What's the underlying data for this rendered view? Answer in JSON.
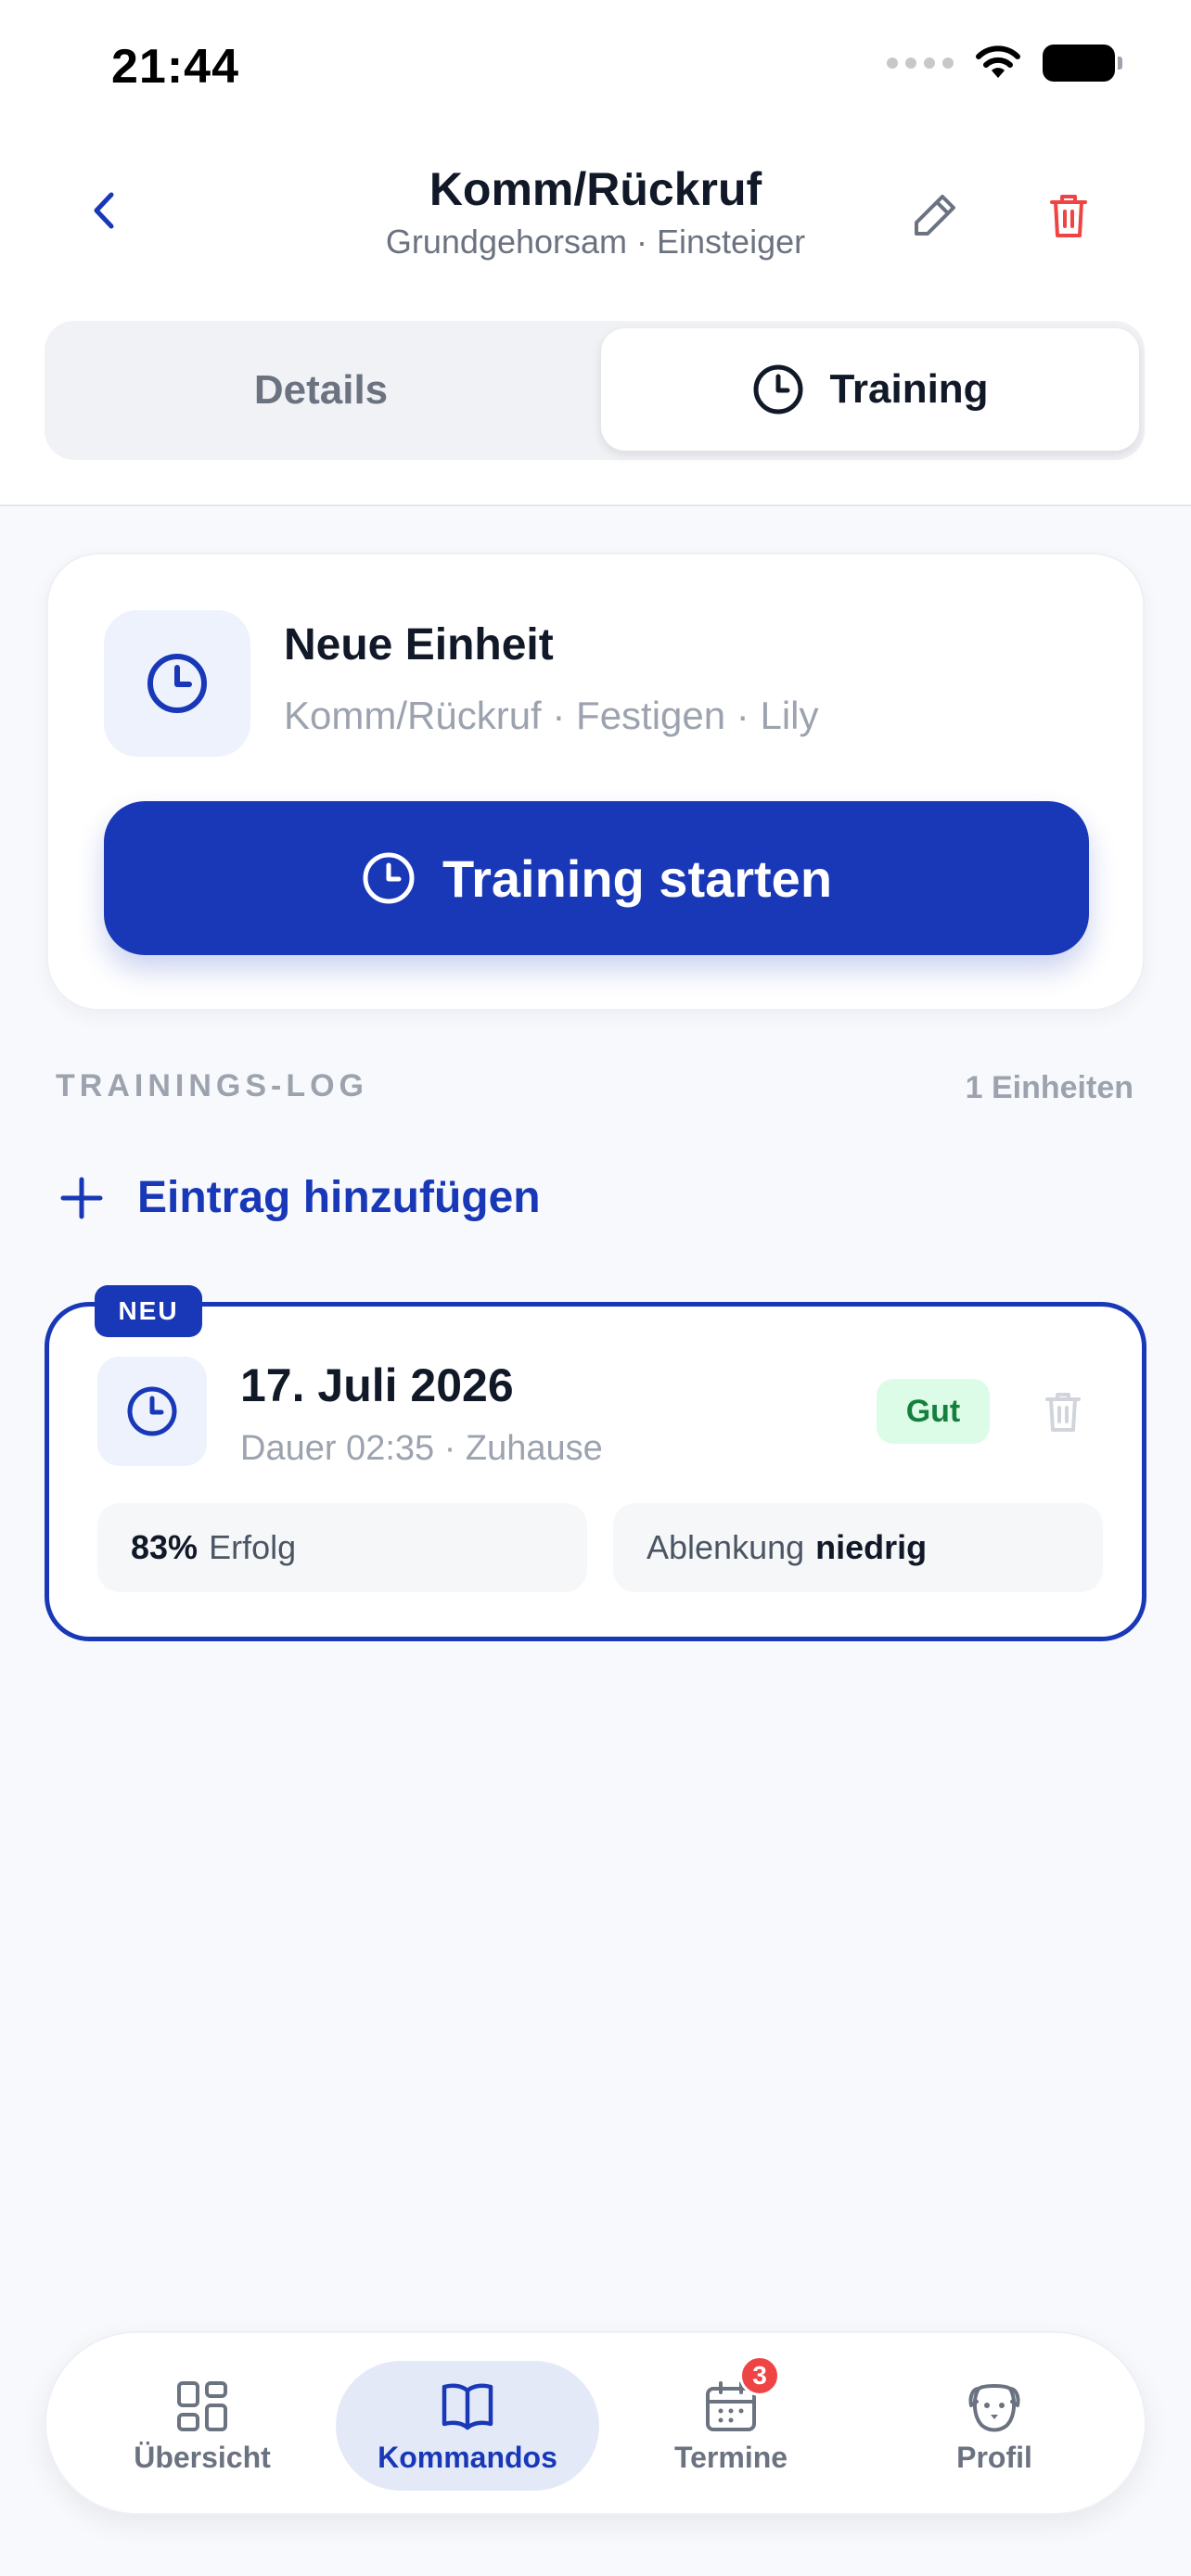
{
  "status_bar": {
    "time": "21:44"
  },
  "header": {
    "title": "Komm/Rückruf",
    "subtitle": "Grundgehorsam · Einsteiger"
  },
  "segments": {
    "details_label": "Details",
    "training_label": "Training",
    "selected": "Training"
  },
  "start_card": {
    "title": "Neue Einheit",
    "subtitle": "Komm/Rückruf · Festigen · Lily",
    "button_label": "Training starten"
  },
  "log": {
    "header": "TRAININGS-LOG",
    "count": "1 Einheiten",
    "add_label": "Eintrag hinzufügen"
  },
  "entry": {
    "badge": "NEU",
    "date": "17. Juli 2026",
    "meta": "Dauer 02:35 · Zuhause",
    "rating": "Gut",
    "success_value": "83%",
    "success_label": "Erfolg",
    "distraction_label": "Ablenkung",
    "distraction_value": "niedrig"
  },
  "tabbar": {
    "items": [
      {
        "label": "Übersicht",
        "icon": "grid-icon"
      },
      {
        "label": "Kommandos",
        "icon": "book-icon"
      },
      {
        "label": "Termine",
        "icon": "calendar-icon",
        "badge": "3"
      },
      {
        "label": "Profil",
        "icon": "dog-icon"
      }
    ],
    "active": "Kommandos"
  },
  "colors": {
    "primary": "#1838b8",
    "danger": "#ef4444",
    "success_bg": "#dcfce7",
    "success_text": "#15803d"
  }
}
